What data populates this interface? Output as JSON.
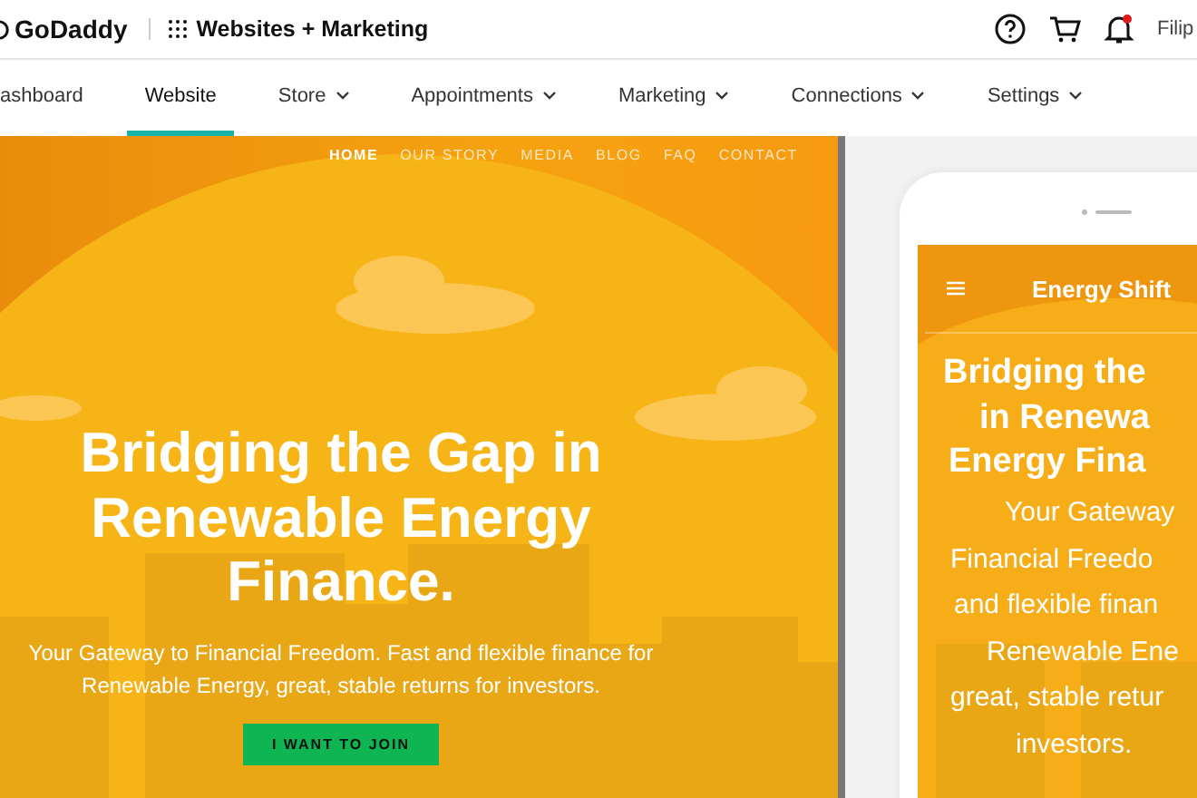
{
  "topbar": {
    "logo": "GoDaddy",
    "product": "Websites + Marketing",
    "user": "Filip"
  },
  "nav": [
    {
      "label": "ashboard",
      "selected": false,
      "has_menu": false
    },
    {
      "label": "Website",
      "selected": true,
      "has_menu": false
    },
    {
      "label": "Store",
      "selected": false,
      "has_menu": true
    },
    {
      "label": "Appointments",
      "selected": false,
      "has_menu": true
    },
    {
      "label": "Marketing",
      "selected": false,
      "has_menu": true
    },
    {
      "label": "Connections",
      "selected": false,
      "has_menu": true
    },
    {
      "label": "Settings",
      "selected": false,
      "has_menu": true
    }
  ],
  "desktop_preview": {
    "menu": [
      {
        "label": "HOME",
        "selected": true
      },
      {
        "label": "OUR STORY",
        "selected": false
      },
      {
        "label": "MEDIA",
        "selected": false
      },
      {
        "label": "BLOG",
        "selected": false
      },
      {
        "label": "FAQ",
        "selected": false
      },
      {
        "label": "CONTACT",
        "selected": false
      }
    ],
    "heading": "Bridging the Gap in Renewable Energy Finance.",
    "subtitle": "Your Gateway to Financial Freedom. Fast and flexible finance for Renewable Energy, great, stable returns for investors.",
    "button": "I WANT TO JOIN"
  },
  "mobile_preview": {
    "site_name": "Energy Shift",
    "heading_lines": [
      "Bridging the",
      "in Renewa",
      "Energy Fina"
    ],
    "subtitle_lines": [
      "Your Gateway",
      "Financial Freedo",
      "and flexible finan",
      "Renewable Ene",
      "great, stable retur",
      "investors."
    ]
  }
}
